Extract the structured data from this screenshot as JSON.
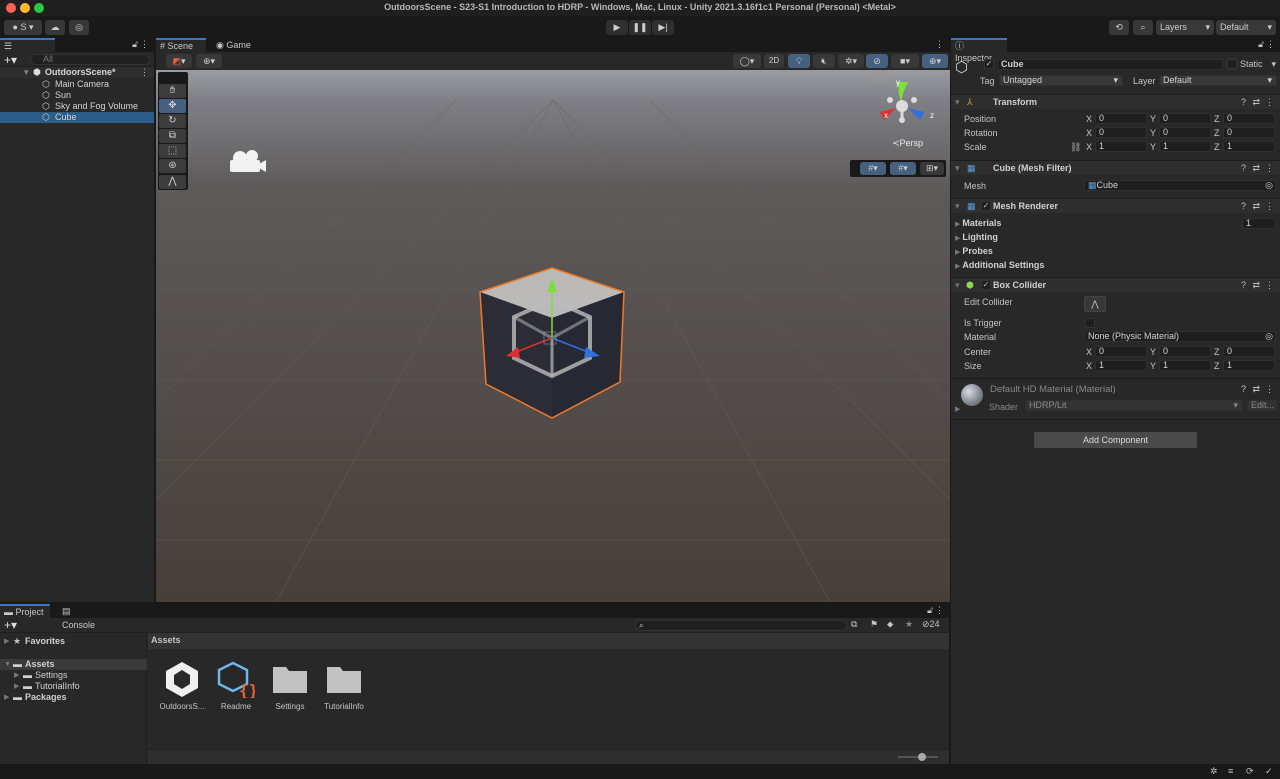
{
  "window": {
    "title": "OutdoorsScene - S23-S1 Introduction to HDRP - Windows, Mac, Linux - Unity 2021.3.16f1c1 Personal (Personal) <Metal>"
  },
  "toolbar": {
    "account_label": "S",
    "layers_label": "Layers",
    "layout_label": "Default"
  },
  "hierarchy": {
    "tab_label": "Hierarchy",
    "search_placeholder": "All",
    "scene_name": "OutdoorsScene*",
    "items": [
      {
        "label": "Main Camera",
        "selected": false
      },
      {
        "label": "Sun",
        "selected": false
      },
      {
        "label": "Sky and Fog Volume",
        "selected": false
      },
      {
        "label": "Cube",
        "selected": true
      }
    ]
  },
  "scene_view": {
    "tabs": [
      {
        "label": "Scene",
        "active": true
      },
      {
        "label": "Game",
        "active": false
      }
    ],
    "mode_2d_label": "2D",
    "projection_label": "Persp",
    "gizmo_axes": {
      "x": "x",
      "y": "y",
      "z": "z"
    },
    "tools": [
      "hand",
      "move",
      "rotate",
      "scale",
      "rect",
      "transform",
      "custom"
    ],
    "active_tool": "move",
    "colors": {
      "x_axis": "#d8322d",
      "y_axis": "#7be03a",
      "z_axis": "#2f6fe0",
      "selection_outline": "#f07a2a"
    }
  },
  "inspector": {
    "tab_label": "Inspector",
    "object_name": "Cube",
    "static_label": "Static",
    "tag_label": "Tag",
    "tag_value": "Untagged",
    "layer_label": "Layer",
    "layer_value": "Default",
    "transform": {
      "title": "Transform",
      "rows": [
        {
          "label": "Position",
          "x": "0",
          "y": "0",
          "z": "0"
        },
        {
          "label": "Rotation",
          "x": "0",
          "y": "0",
          "z": "0"
        },
        {
          "label": "Scale",
          "x": "1",
          "y": "1",
          "z": "1"
        }
      ]
    },
    "mesh_filter": {
      "title": "Cube (Mesh Filter)",
      "mesh_label": "Mesh",
      "mesh_value": "Cube"
    },
    "mesh_renderer": {
      "title": "Mesh Renderer",
      "sections": [
        "Materials",
        "Lighting",
        "Probes",
        "Additional Settings"
      ],
      "materials_count": "1"
    },
    "box_collider": {
      "title": "Box Collider",
      "edit_collider_label": "Edit Collider",
      "is_trigger_label": "Is Trigger",
      "material_label": "Material",
      "material_value": "None (Physic Material)",
      "center": {
        "label": "Center",
        "x": "0",
        "y": "0",
        "z": "0"
      },
      "size": {
        "label": "Size",
        "x": "1",
        "y": "1",
        "z": "1"
      }
    },
    "material": {
      "title": "Default HD Material (Material)",
      "shader_label": "Shader",
      "shader_value": "HDRP/Lit",
      "edit_label": "Edit..."
    },
    "add_component_label": "Add Component",
    "axis_labels": {
      "x": "X",
      "y": "Y",
      "z": "Z"
    }
  },
  "project": {
    "tabs": [
      {
        "label": "Project",
        "active": true
      },
      {
        "label": "Console",
        "active": false
      }
    ],
    "tree": [
      {
        "label": "Favorites",
        "indent": 0
      },
      {
        "label": "Assets",
        "indent": 0,
        "selected": true
      },
      {
        "label": "Settings",
        "indent": 1
      },
      {
        "label": "TutorialInfo",
        "indent": 1
      },
      {
        "label": "Packages",
        "indent": 0
      }
    ],
    "breadcrumb": "Assets",
    "hidden_count": "24",
    "assets": [
      {
        "label": "OutdoorsS...",
        "icon": "unity-scene-icon"
      },
      {
        "label": "Readme",
        "icon": "script-asset-icon"
      },
      {
        "label": "Settings",
        "icon": "folder-icon"
      },
      {
        "label": "TutorialInfo",
        "icon": "folder-icon"
      }
    ],
    "icon_size_fraction": 0.6
  }
}
